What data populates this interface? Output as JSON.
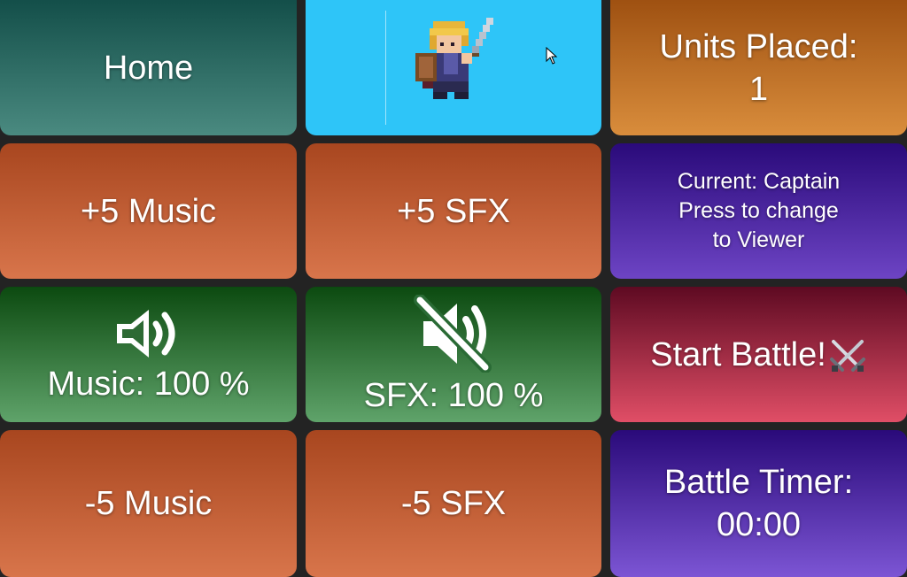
{
  "tiles": {
    "home": {
      "label": "Home"
    },
    "units_placed": {
      "line1": "Units Placed:",
      "line2": "1"
    },
    "music_up": {
      "label": "+5 Music"
    },
    "sfx_up": {
      "label": "+5 SFX"
    },
    "role": {
      "line1": "Current: Captain",
      "line2": "Press to change",
      "line3": "to Viewer"
    },
    "music_volume": {
      "label": "Music: 100 %",
      "icon": "speaker-icon"
    },
    "sfx_volume": {
      "label": "SFX: 100 %",
      "icon": "speaker-muted-icon"
    },
    "start_battle": {
      "label": "Start Battle!",
      "icon": "crossed-swords-icon"
    },
    "music_down": {
      "label": "-5 Music"
    },
    "sfx_down": {
      "label": "-5 SFX"
    },
    "battle_timer": {
      "line1": "Battle Timer:",
      "line2": "00:00"
    },
    "avatar": {
      "icon": "knight-sprite-icon"
    }
  },
  "colors": {
    "background": "#232323",
    "teal": "#2f6b64",
    "sky": "#2ec5f8",
    "amber": "#c8752b",
    "rust": "#c8603a",
    "violet": "#4a2aa0",
    "forest": "#2f7a3a",
    "crimson": "#b02c47"
  }
}
